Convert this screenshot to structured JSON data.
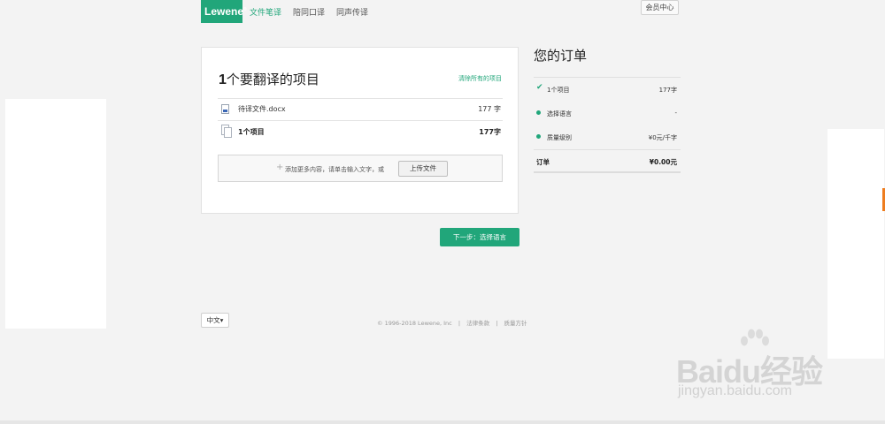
{
  "header": {
    "logo": "Lewene",
    "logo_mark": "®",
    "nav": [
      "文件笔译",
      "陪同口译",
      "同声传译"
    ],
    "member_center": "会员中心"
  },
  "project_card": {
    "count": "1",
    "title_suffix": "个要翻译的项目",
    "clear_all": "清除所有的项目",
    "file": {
      "name": "待译文件.docx",
      "count": "177 字",
      "icon": "docx-file-icon"
    },
    "total": {
      "label": "1个项目",
      "count": "177字",
      "icon": "file-stack-icon"
    },
    "add_more": {
      "icon": "plus-icon",
      "text": "添加更多内容，请单击输入文字，或",
      "upload_button": "上传文件"
    }
  },
  "next_button": "下一步：选择语言",
  "order": {
    "title": "您的订单",
    "rows": [
      {
        "icon": "check-icon",
        "label": "1个项目",
        "value": "177字"
      },
      {
        "icon": "dot-icon",
        "label": "选择语言",
        "value": "-"
      },
      {
        "icon": "dot-icon",
        "label": "质量级别",
        "value": "¥0元/千字"
      }
    ],
    "total": {
      "label": "订单",
      "value": "¥0.00元"
    }
  },
  "footer": {
    "language": "中文",
    "language_caret": "▾",
    "copyright": "© 1996-2018 Lewene, Inc",
    "links": [
      "法律条款",
      "质量方针"
    ],
    "separator": "|"
  },
  "watermark": {
    "brand": "Baidu经验",
    "url": "jingyan.baidu.com"
  },
  "colors": {
    "accent": "#21a67a",
    "background": "#f3f3f3",
    "side_tab": "#ee7d1f"
  }
}
